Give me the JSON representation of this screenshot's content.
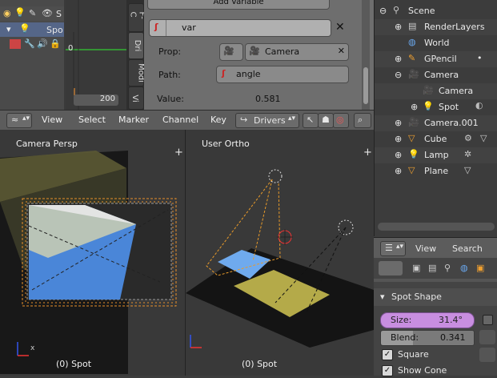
{
  "channels": {
    "row1_label": "S",
    "row2_label": "Spo"
  },
  "graph": {
    "frame_value": "200",
    "zero_label": "0"
  },
  "side_tabs": [
    "F-C",
    "Dri",
    "Modi",
    "Vi"
  ],
  "driver": {
    "add_variable_label": "Add Variable",
    "var_name": "var",
    "prop_label": "Prop:",
    "prop_value": "Camera",
    "path_label": "Path:",
    "path_value": "angle",
    "value_label": "Value:",
    "value_value": "0.581"
  },
  "ge_header": {
    "menus": [
      "View",
      "Select",
      "Marker",
      "Channel",
      "Key"
    ],
    "mode_label": "Drivers"
  },
  "viewport_left": {
    "title": "Camera Persp",
    "footer": "(0) Spot"
  },
  "viewport_right": {
    "title": "User Ortho",
    "footer": "(0) Spot"
  },
  "outliner": {
    "items": [
      {
        "label": "Scene"
      },
      {
        "label": "RenderLayers"
      },
      {
        "label": "World"
      },
      {
        "label": "GPencil"
      },
      {
        "label": "Camera"
      },
      {
        "label": "Camera"
      },
      {
        "label": "Spot"
      },
      {
        "label": "Camera.001"
      },
      {
        "label": "Cube"
      },
      {
        "label": "Lamp"
      },
      {
        "label": "Plane"
      }
    ]
  },
  "props_header": {
    "menus": [
      "View",
      "Search"
    ]
  },
  "spot_shape": {
    "title": "Spot Shape",
    "size_label": "Size:",
    "size_value": "31.4°",
    "blend_label": "Blend:",
    "blend_value": "0.341",
    "square_label": "Square",
    "show_cone_label": "Show Cone"
  },
  "colors": {
    "selected_purple": "#c88ee0",
    "accent_orange": "#f0a030",
    "light_yellow": "#d8c860",
    "blue_plane": "#4a8ce0"
  }
}
